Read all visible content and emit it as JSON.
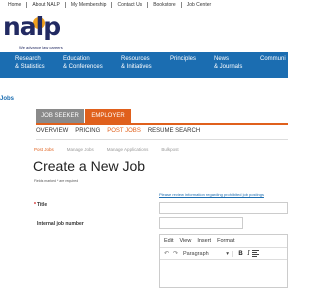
{
  "topbar": {
    "links": [
      "Home",
      "About NALP",
      "My Membership",
      "Contact Us",
      "Bookstore",
      "Job Center"
    ]
  },
  "logo": {
    "word": "nalp",
    "tagline": "We advance law careers"
  },
  "mainnav": {
    "items": [
      {
        "line1": "Research",
        "line2": "& Statistics"
      },
      {
        "line1": "Education",
        "line2": "& Conferences"
      },
      {
        "line1": "Resources",
        "line2": "& Initiatives"
      },
      {
        "line1": "Principles",
        "line2": ""
      },
      {
        "line1": "News",
        "line2": "& Journals"
      },
      {
        "line1": "Communi",
        "line2": ""
      }
    ]
  },
  "sidebar": {
    "cut_label": "Jobs"
  },
  "role_tabs": {
    "seeker": "JOB SEEKER",
    "employer": "EMPLOYER"
  },
  "subnav": {
    "items": [
      "OVERVIEW",
      "PRICING",
      "POST JOBS",
      "RESUME SEARCH"
    ],
    "active": "POST JOBS"
  },
  "crumbs": {
    "items": [
      "Post Jobs",
      "Manage Jobs",
      "Manage Applications",
      "Bulkpost"
    ],
    "active": "Post Jobs"
  },
  "page": {
    "title": "Create a New Job",
    "required_note": "Fields marked * are required",
    "guideline_link": "Please review information regarding prohibited job postings"
  },
  "form": {
    "title_label": "Title",
    "title_required_marker": "*",
    "title_value": "",
    "number_label": "Internal job number",
    "number_value": ""
  },
  "editor": {
    "menu": [
      "Edit",
      "View",
      "Insert",
      "Format"
    ],
    "undo_icon": "undo-icon",
    "redo_icon": "redo-icon",
    "format_select": "Paragraph",
    "bold_label": "B",
    "italic_label": "I"
  },
  "colors": {
    "nav_blue": "#1b6db1",
    "accent_orange": "#e0601c",
    "logo_navy": "#222a62",
    "logo_orange": "#f0a01e"
  }
}
